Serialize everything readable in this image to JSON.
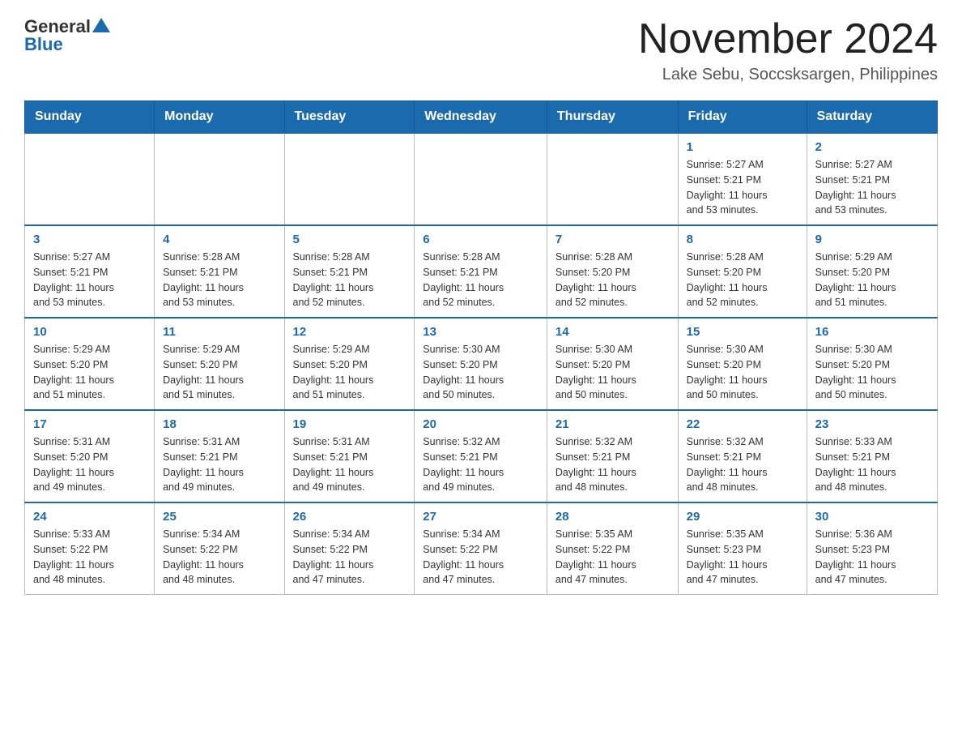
{
  "header": {
    "logo_general": "General",
    "logo_blue": "Blue",
    "month_title": "November 2024",
    "location": "Lake Sebu, Soccsksargen, Philippines"
  },
  "weekdays": [
    "Sunday",
    "Monday",
    "Tuesday",
    "Wednesday",
    "Thursday",
    "Friday",
    "Saturday"
  ],
  "weeks": [
    [
      {
        "day": "",
        "info": ""
      },
      {
        "day": "",
        "info": ""
      },
      {
        "day": "",
        "info": ""
      },
      {
        "day": "",
        "info": ""
      },
      {
        "day": "",
        "info": ""
      },
      {
        "day": "1",
        "info": "Sunrise: 5:27 AM\nSunset: 5:21 PM\nDaylight: 11 hours\nand 53 minutes."
      },
      {
        "day": "2",
        "info": "Sunrise: 5:27 AM\nSunset: 5:21 PM\nDaylight: 11 hours\nand 53 minutes."
      }
    ],
    [
      {
        "day": "3",
        "info": "Sunrise: 5:27 AM\nSunset: 5:21 PM\nDaylight: 11 hours\nand 53 minutes."
      },
      {
        "day": "4",
        "info": "Sunrise: 5:28 AM\nSunset: 5:21 PM\nDaylight: 11 hours\nand 53 minutes."
      },
      {
        "day": "5",
        "info": "Sunrise: 5:28 AM\nSunset: 5:21 PM\nDaylight: 11 hours\nand 52 minutes."
      },
      {
        "day": "6",
        "info": "Sunrise: 5:28 AM\nSunset: 5:21 PM\nDaylight: 11 hours\nand 52 minutes."
      },
      {
        "day": "7",
        "info": "Sunrise: 5:28 AM\nSunset: 5:20 PM\nDaylight: 11 hours\nand 52 minutes."
      },
      {
        "day": "8",
        "info": "Sunrise: 5:28 AM\nSunset: 5:20 PM\nDaylight: 11 hours\nand 52 minutes."
      },
      {
        "day": "9",
        "info": "Sunrise: 5:29 AM\nSunset: 5:20 PM\nDaylight: 11 hours\nand 51 minutes."
      }
    ],
    [
      {
        "day": "10",
        "info": "Sunrise: 5:29 AM\nSunset: 5:20 PM\nDaylight: 11 hours\nand 51 minutes."
      },
      {
        "day": "11",
        "info": "Sunrise: 5:29 AM\nSunset: 5:20 PM\nDaylight: 11 hours\nand 51 minutes."
      },
      {
        "day": "12",
        "info": "Sunrise: 5:29 AM\nSunset: 5:20 PM\nDaylight: 11 hours\nand 51 minutes."
      },
      {
        "day": "13",
        "info": "Sunrise: 5:30 AM\nSunset: 5:20 PM\nDaylight: 11 hours\nand 50 minutes."
      },
      {
        "day": "14",
        "info": "Sunrise: 5:30 AM\nSunset: 5:20 PM\nDaylight: 11 hours\nand 50 minutes."
      },
      {
        "day": "15",
        "info": "Sunrise: 5:30 AM\nSunset: 5:20 PM\nDaylight: 11 hours\nand 50 minutes."
      },
      {
        "day": "16",
        "info": "Sunrise: 5:30 AM\nSunset: 5:20 PM\nDaylight: 11 hours\nand 50 minutes."
      }
    ],
    [
      {
        "day": "17",
        "info": "Sunrise: 5:31 AM\nSunset: 5:20 PM\nDaylight: 11 hours\nand 49 minutes."
      },
      {
        "day": "18",
        "info": "Sunrise: 5:31 AM\nSunset: 5:21 PM\nDaylight: 11 hours\nand 49 minutes."
      },
      {
        "day": "19",
        "info": "Sunrise: 5:31 AM\nSunset: 5:21 PM\nDaylight: 11 hours\nand 49 minutes."
      },
      {
        "day": "20",
        "info": "Sunrise: 5:32 AM\nSunset: 5:21 PM\nDaylight: 11 hours\nand 49 minutes."
      },
      {
        "day": "21",
        "info": "Sunrise: 5:32 AM\nSunset: 5:21 PM\nDaylight: 11 hours\nand 48 minutes."
      },
      {
        "day": "22",
        "info": "Sunrise: 5:32 AM\nSunset: 5:21 PM\nDaylight: 11 hours\nand 48 minutes."
      },
      {
        "day": "23",
        "info": "Sunrise: 5:33 AM\nSunset: 5:21 PM\nDaylight: 11 hours\nand 48 minutes."
      }
    ],
    [
      {
        "day": "24",
        "info": "Sunrise: 5:33 AM\nSunset: 5:22 PM\nDaylight: 11 hours\nand 48 minutes."
      },
      {
        "day": "25",
        "info": "Sunrise: 5:34 AM\nSunset: 5:22 PM\nDaylight: 11 hours\nand 48 minutes."
      },
      {
        "day": "26",
        "info": "Sunrise: 5:34 AM\nSunset: 5:22 PM\nDaylight: 11 hours\nand 47 minutes."
      },
      {
        "day": "27",
        "info": "Sunrise: 5:34 AM\nSunset: 5:22 PM\nDaylight: 11 hours\nand 47 minutes."
      },
      {
        "day": "28",
        "info": "Sunrise: 5:35 AM\nSunset: 5:22 PM\nDaylight: 11 hours\nand 47 minutes."
      },
      {
        "day": "29",
        "info": "Sunrise: 5:35 AM\nSunset: 5:23 PM\nDaylight: 11 hours\nand 47 minutes."
      },
      {
        "day": "30",
        "info": "Sunrise: 5:36 AM\nSunset: 5:23 PM\nDaylight: 11 hours\nand 47 minutes."
      }
    ]
  ],
  "accent_color": "#1a6aad"
}
